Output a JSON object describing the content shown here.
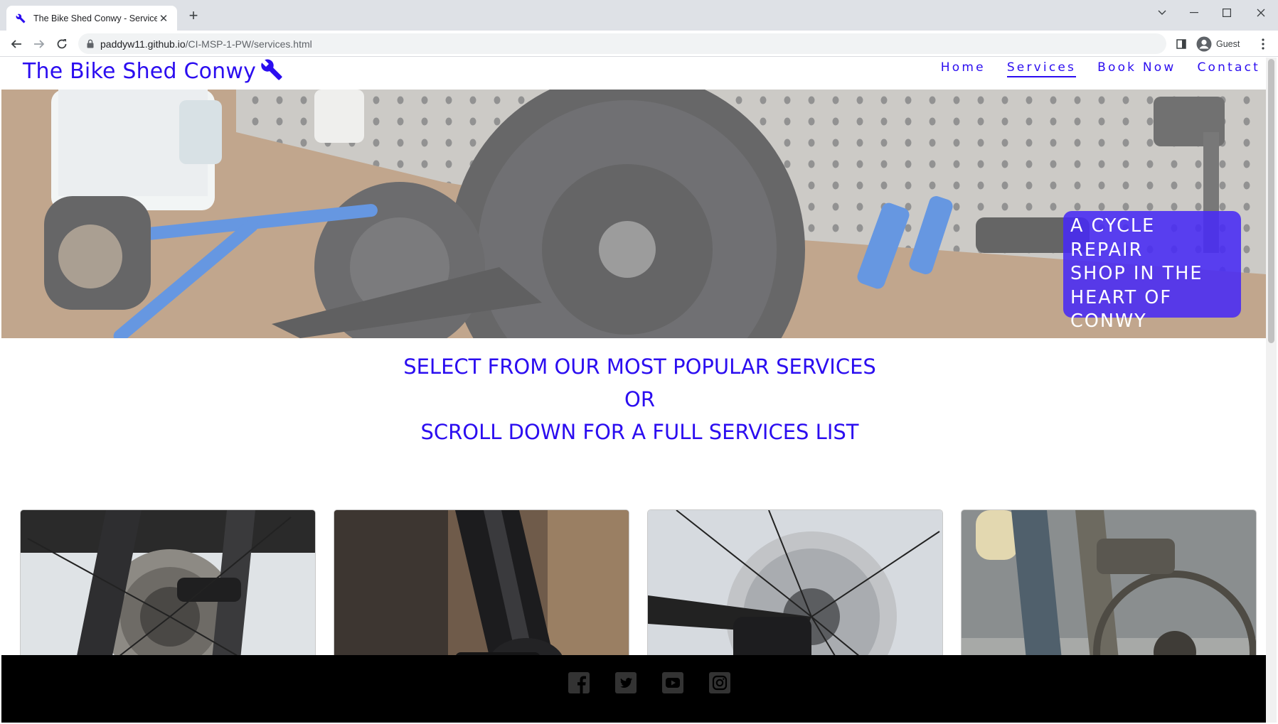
{
  "browser": {
    "tab_title": "The Bike Shed Conwy - Services",
    "url_host": "paddyw11.github.io",
    "url_path": "/CI-MSP-1-PW/services.html",
    "profile_label": "Guest",
    "icons": [
      "wrench-icon",
      "close-icon",
      "plus-icon",
      "chevron-down-icon",
      "minimize-icon",
      "maximize-icon",
      "close-window-icon",
      "back-arrow-icon",
      "forward-arrow-icon",
      "reload-icon",
      "lock-icon",
      "sidebar-icon",
      "profile-icon",
      "kebab-menu-icon"
    ]
  },
  "site": {
    "brand": "The Bike Shed Conwy",
    "brand_icon": "wrench-icon",
    "nav": [
      {
        "label": "Home",
        "active": false
      },
      {
        "label": "Services",
        "active": true
      },
      {
        "label": "Book Now",
        "active": false
      },
      {
        "label": "Contact",
        "active": false
      }
    ],
    "hero_badge": [
      "A CYCLE REPAIR",
      "SHOP IN THE",
      "HEART OF",
      "CONWY"
    ],
    "intro": [
      "SELECT FROM OUR MOST POPULAR SERVICES",
      "OR",
      "SCROLL DOWN FOR A FULL SERVICES LIST"
    ],
    "cards": [
      "rear-cassette-photo",
      "frame-detail-photo",
      "disc-brake-photo",
      "muddy-bike-photo"
    ],
    "social": [
      "facebook-icon",
      "twitter-icon",
      "youtube-icon",
      "instagram-icon"
    ]
  },
  "colors": {
    "brand_blue": "#2b0df0",
    "badge_bg": "#482af5",
    "footer_bg": "#000000",
    "social_icon": "#333333"
  }
}
